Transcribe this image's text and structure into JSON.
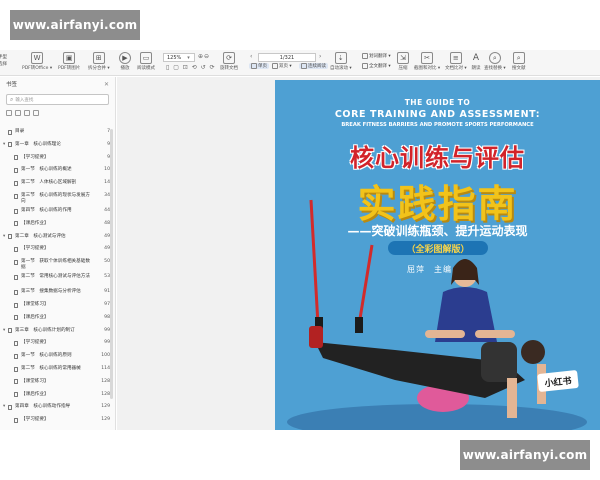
{
  "watermarks": {
    "top": "www.airfanyi.com",
    "bottom": "www.airfanyi.com"
  },
  "toolbar": {
    "items": [
      {
        "icon": "select-icon",
        "label": "选择"
      },
      {
        "icon": "pdf-to-office-icon",
        "label": "PDF转Office ▾"
      },
      {
        "icon": "pdf-to-image-icon",
        "label": "PDF转图片"
      },
      {
        "icon": "split-merge-icon",
        "label": "拆分合并 ▾"
      },
      {
        "icon": "play-icon",
        "label": "播放"
      },
      {
        "icon": "reading-mode-icon",
        "label": "阅读模式"
      },
      {
        "icon": "rotate-doc-icon",
        "label": "旋转文档"
      },
      {
        "icon": "auto-scroll-icon",
        "label": "自动滚动 ▾"
      },
      {
        "icon": "translate-icon",
        "label": "划词翻译 ▾"
      },
      {
        "icon": "full-translate-icon",
        "label": "全文翻译 ▾"
      },
      {
        "icon": "compress-icon",
        "label": "压缩"
      },
      {
        "icon": "screenshot-compare-icon",
        "label": "截图和对比 ▾"
      },
      {
        "icon": "text-compare-icon",
        "label": "文档比对 ▾"
      },
      {
        "icon": "read-aloud-icon",
        "label": "朗读"
      },
      {
        "icon": "find-replace-icon",
        "label": "查找替换 ▾"
      },
      {
        "icon": "search-icon",
        "label": "搜文献"
      }
    ],
    "partial_left": "手型",
    "zoom": "125%",
    "page_indicator": "1/321",
    "single_page": "单页",
    "double_page": "双页 ▾",
    "continuous": "连续阅读"
  },
  "sidebar": {
    "title": "书签",
    "close": "✕",
    "search_placeholder": "输入查找",
    "toc": [
      {
        "label": "目录",
        "page": "7",
        "level": 0,
        "arrow": ""
      },
      {
        "label": "第一章　核心训练理论",
        "page": "9",
        "level": 0,
        "arrow": "▾"
      },
      {
        "label": "【学习提要】",
        "page": "9",
        "level": 1,
        "arrow": ""
      },
      {
        "label": "第一节　核心训练的概述",
        "page": "10",
        "level": 1,
        "arrow": ""
      },
      {
        "label": "第二节　人体核心区域解剖",
        "page": "14",
        "level": 1,
        "arrow": ""
      },
      {
        "label": "第三节　核心训练的现状与发展方向",
        "page": "34",
        "level": 1,
        "arrow": ""
      },
      {
        "label": "第四节　核心训练的作用",
        "page": "44",
        "level": 1,
        "arrow": ""
      },
      {
        "label": "【课后作业】",
        "page": "48",
        "level": 1,
        "arrow": ""
      },
      {
        "label": "第二章　核心测试与评估",
        "page": "49",
        "level": 0,
        "arrow": "▾"
      },
      {
        "label": "【学习提要】",
        "page": "49",
        "level": 1,
        "arrow": ""
      },
      {
        "label": "第一节　获取个体训练相关基础数据",
        "page": "50",
        "level": 1,
        "arrow": ""
      },
      {
        "label": "第二节　常用核心测试与评估方法",
        "page": "53",
        "level": 1,
        "arrow": ""
      },
      {
        "label": "第三节　搜集数据与分析评估",
        "page": "91",
        "level": 1,
        "arrow": ""
      },
      {
        "label": "【课堂练习】",
        "page": "97",
        "level": 1,
        "arrow": ""
      },
      {
        "label": "【课后作业】",
        "page": "98",
        "level": 1,
        "arrow": ""
      },
      {
        "label": "第三章　核心训练计划的制订",
        "page": "99",
        "level": 0,
        "arrow": "▾"
      },
      {
        "label": "【学习提要】",
        "page": "99",
        "level": 1,
        "arrow": ""
      },
      {
        "label": "第一节　核心训练的原则",
        "page": "100",
        "level": 1,
        "arrow": ""
      },
      {
        "label": "第二节　核心训练的常用器械",
        "page": "114",
        "level": 1,
        "arrow": ""
      },
      {
        "label": "【课堂练习】",
        "page": "128",
        "level": 1,
        "arrow": ""
      },
      {
        "label": "【课后作业】",
        "page": "128",
        "level": 1,
        "arrow": ""
      },
      {
        "label": "第四章　核心训练动作指导",
        "page": "129",
        "level": 0,
        "arrow": "▾"
      },
      {
        "label": "【学习提要】",
        "page": "129",
        "level": 1,
        "arrow": ""
      }
    ]
  },
  "cover": {
    "en_line1": "THE GUIDE TO",
    "en_line2": "CORE TRAINING AND ASSESSMENT:",
    "en_line3": "BREAK FITNESS BARRIERS AND PROMOTE SPORTS PERFORMANCE",
    "zh_title1": "核心训练与评估",
    "zh_title2": "实践指南",
    "zh_subtitle": "——突破训练瓶颈、提升运动表现",
    "badge": "（全彩图解版）",
    "author": "屈萍　主编",
    "logo": "小红书"
  },
  "colors": {
    "cover_bg": "#4ea0d3",
    "title_red": "#d2232a",
    "title_yellow": "#f2c31a",
    "badge_blue": "#1d74b4"
  }
}
